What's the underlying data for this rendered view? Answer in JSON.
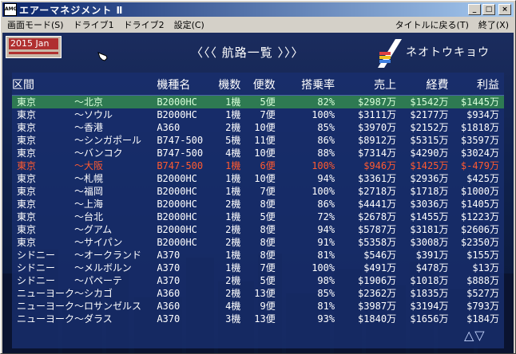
{
  "window": {
    "app_icon": "AMG",
    "title": "エアーマネジメント Ⅱ",
    "buttons": {
      "minimize": "_",
      "maximize": "□",
      "close": "×"
    }
  },
  "menu": {
    "items": [
      "画面モード(S)",
      "ドライブ1",
      "ドライブ2",
      "設定(C)"
    ],
    "right_items": [
      "タイトルに戻る(T)",
      "終了(X)"
    ]
  },
  "game": {
    "date": "2015 Jan",
    "panel_title": "〈〈〈 航路一覧 〉〉〉",
    "airline_name": "ネオトウキョウ",
    "scroll_arrows": "△▽"
  },
  "table": {
    "headers": [
      "区間",
      "機種名",
      "機数",
      "便数",
      "搭乗率",
      "売上",
      "経費",
      "利益"
    ],
    "selected_row": 0,
    "loss_row": 5,
    "rows": [
      [
        "東京",
        "～北京",
        "B2000HC",
        "1機",
        "5便",
        "82%",
        "$2987万",
        "$1542万",
        "$1445万"
      ],
      [
        "東京",
        "～ソウル",
        "B2000HC",
        "1機",
        "7便",
        "100%",
        "$3111万",
        "$2177万",
        "$934万"
      ],
      [
        "東京",
        "～香港",
        "A360",
        "2機",
        "10便",
        "85%",
        "$3970万",
        "$2152万",
        "$1818万"
      ],
      [
        "東京",
        "～シンガポール",
        "B747-500",
        "5機",
        "11便",
        "86%",
        "$8912万",
        "$5315万",
        "$3597万"
      ],
      [
        "東京",
        "～バンコク",
        "B747-500",
        "4機",
        "10便",
        "88%",
        "$7314万",
        "$4290万",
        "$3024万"
      ],
      [
        "東京",
        "～大阪",
        "B747-500",
        "1機",
        "6便",
        "100%",
        "$946万",
        "$1425万",
        "$-479万"
      ],
      [
        "東京",
        "～札幌",
        "B2000HC",
        "1機",
        "10便",
        "94%",
        "$3361万",
        "$2936万",
        "$425万"
      ],
      [
        "東京",
        "～福岡",
        "B2000HC",
        "1機",
        "7便",
        "100%",
        "$2718万",
        "$1718万",
        "$1000万"
      ],
      [
        "東京",
        "～上海",
        "B2000HC",
        "2機",
        "8便",
        "86%",
        "$4441万",
        "$3036万",
        "$1405万"
      ],
      [
        "東京",
        "～台北",
        "B2000HC",
        "1機",
        "5便",
        "72%",
        "$2678万",
        "$1455万",
        "$1223万"
      ],
      [
        "東京",
        "～グアム",
        "B2000HC",
        "2機",
        "8便",
        "94%",
        "$5787万",
        "$3181万",
        "$2606万"
      ],
      [
        "東京",
        "～サイパン",
        "B2000HC",
        "2機",
        "8便",
        "91%",
        "$5358万",
        "$3008万",
        "$2350万"
      ],
      [
        "シドニー",
        "～オークランド",
        "A370",
        "1機",
        "8便",
        "81%",
        "$546万",
        "$391万",
        "$155万"
      ],
      [
        "シドニー",
        "～メルボルン",
        "A370",
        "1機",
        "7便",
        "100%",
        "$491万",
        "$478万",
        "$13万"
      ],
      [
        "シドニー",
        "～パペーテ",
        "A370",
        "2機",
        "5便",
        "98%",
        "$1906万",
        "$1018万",
        "$888万"
      ],
      [
        "ニューヨーク",
        "～シカゴ",
        "A360",
        "2機",
        "13便",
        "85%",
        "$2362万",
        "$1835万",
        "$527万"
      ],
      [
        "ニューヨーク",
        "～ロサンゼルス",
        "A360",
        "4機",
        "9便",
        "81%",
        "$3987万",
        "$3194万",
        "$793万"
      ],
      [
        "ニューヨーク",
        "～ダラス",
        "A370",
        "3機",
        "13便",
        "93%",
        "$1840万",
        "$1656万",
        "$184万"
      ]
    ]
  },
  "colors": {
    "title_gradient": [
      "#0a246a",
      "#a6caf0"
    ],
    "selected_row_bg": "#2e7a52",
    "loss_text": "#ff5a30",
    "table_bg": "#182e6e"
  }
}
